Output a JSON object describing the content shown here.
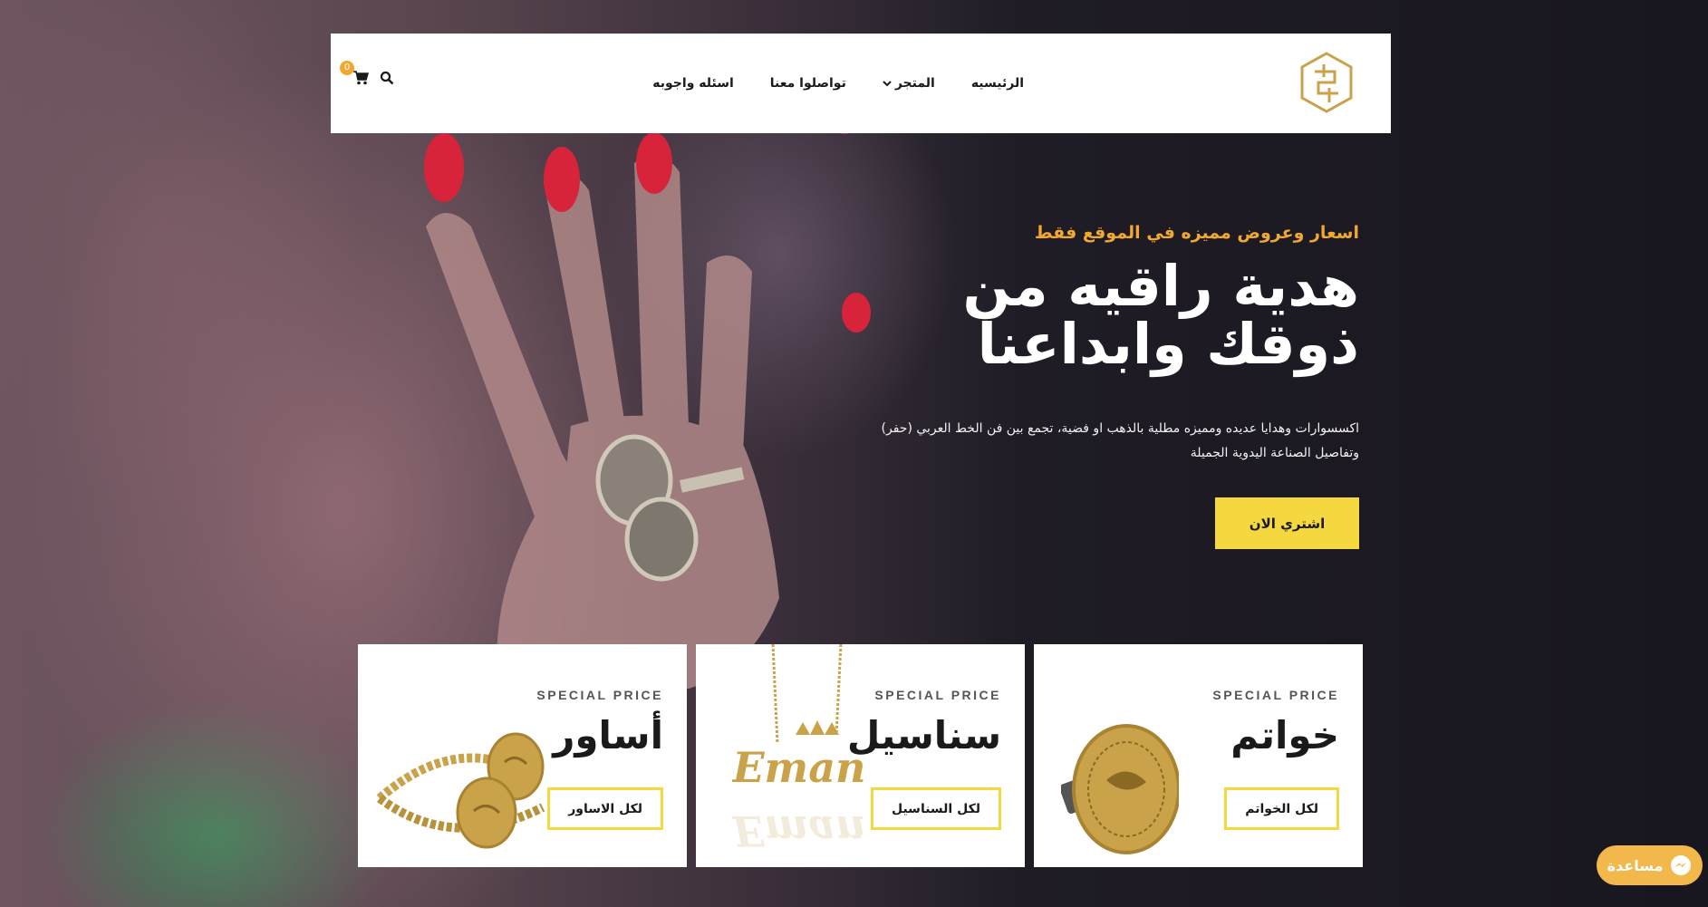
{
  "header": {
    "logo_name": "arabic-monogram-logo",
    "nav": [
      {
        "label": "الرئيسيه"
      },
      {
        "label": "المتجر",
        "has_dropdown": true
      },
      {
        "label": "تواصلوا معنا"
      },
      {
        "label": "اسئله واجوبه"
      }
    ],
    "cart_count": "0"
  },
  "hero": {
    "subtitle": "اسعار وعروض مميزه في الموقع فقط",
    "title_line1": "هدية راقيه من",
    "title_line2": "ذوقك وابداعنا",
    "desc_line1": "اكسسوارات وهدايا عديده ومميزه مطلية بالذهب او فضية، تجمع بين فن الخط العربي (حفر)",
    "desc_line2": "وتفاصيل الصناعة اليدوية الجميلة",
    "cta_label": "اشتري الان"
  },
  "cards": [
    {
      "label": "SPECIAL PRICE",
      "title": "خواتم",
      "button": "لكل الخواتم"
    },
    {
      "label": "SPECIAL PRICE",
      "title": "سناسيل",
      "button": "لكل السناسيل"
    },
    {
      "label": "SPECIAL PRICE",
      "title": "أساور",
      "button": "لكل الاساور"
    }
  ],
  "necklace_name": "Eman",
  "help": {
    "label": "مساعدة"
  },
  "colors": {
    "accent": "#f5d83f",
    "gold": "#f0a830",
    "logo": "#c9a24a"
  }
}
